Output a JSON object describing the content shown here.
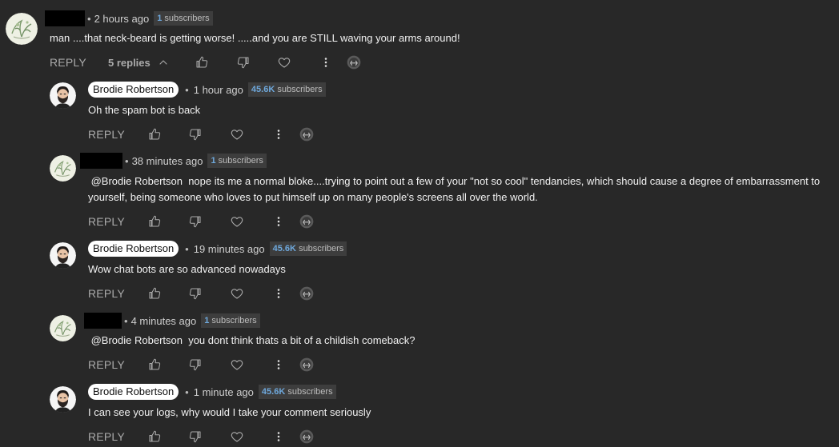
{
  "colors": {
    "background": "#282828",
    "text": "#f1f1f1",
    "muted": "#aaaaaa",
    "redaction": "#000000",
    "subscriber_count": "#6ea8dc",
    "name_pill_bg": "#ffffff"
  },
  "icons": {
    "thumbs_up": "thumbs-up-icon",
    "thumbs_down": "thumbs-down-icon",
    "heart": "heart-icon",
    "more": "more-vertical-icon",
    "extension": "extension-badge-icon",
    "chevron": "chevron-up-icon"
  },
  "thread": {
    "top_comment": {
      "time": "2 hours ago",
      "subscribers_count": "1",
      "subscribers_label": "subscribers",
      "text": "man ....that neck-beard is getting worse! .....and you are STILL waving your arms around!",
      "reply_label": "REPLY",
      "replies_label": "5 replies"
    },
    "replies": [
      {
        "author": "Brodie Robertson",
        "time": "1 hour ago",
        "subscribers_count": "45.6K",
        "subscribers_label": "subscribers",
        "text": "Oh the spam bot is back",
        "reply_label": "REPLY"
      },
      {
        "time": "38 minutes ago",
        "subscribers_count": "1",
        "subscribers_label": "subscribers",
        "text_line1": " @Brodie Robertson  nope its me a normal bloke....trying to point out a few of your \"not so cool\" tendancies, which should cause a degree of embarrassment to",
        "text_line2": "yourself, being someone who loves to put himself up on many people's screens all over the world.",
        "reply_label": "REPLY"
      },
      {
        "author": "Brodie Robertson",
        "time": "19 minutes ago",
        "subscribers_count": "45.6K",
        "subscribers_label": "subscribers",
        "text": "Wow chat bots are so advanced nowadays",
        "reply_label": "REPLY"
      },
      {
        "time": "4 minutes ago",
        "subscribers_count": "1",
        "subscribers_label": "subscribers",
        "text": " @Brodie Robertson  you dont think thats a bit of a childish comeback?",
        "reply_label": "REPLY"
      },
      {
        "author": "Brodie Robertson",
        "time": "1 minute ago",
        "subscribers_count": "45.6K",
        "subscribers_label": "subscribers",
        "text": "I can see your logs, why would I take your comment seriously",
        "reply_label": "REPLY"
      }
    ]
  }
}
